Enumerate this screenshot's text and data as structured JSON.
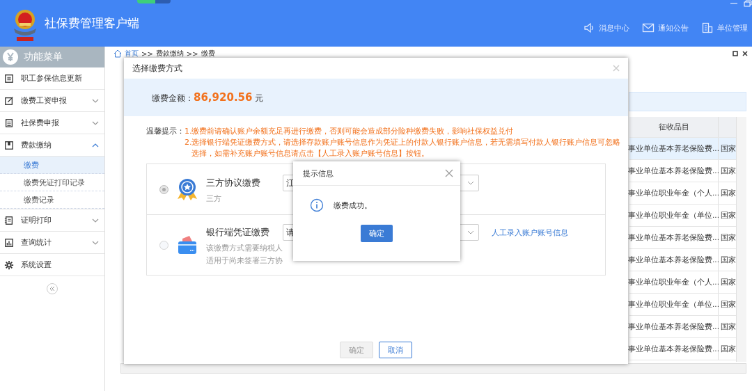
{
  "app": {
    "title": "社保费管理客户端"
  },
  "header_links": [
    {
      "label": "消息中心"
    },
    {
      "label": "通知公告"
    },
    {
      "label": "单位管理"
    }
  ],
  "sidebar": {
    "title": "功能菜单",
    "items": [
      {
        "label": "职工参保信息更新"
      },
      {
        "label": "缴费工资申报",
        "expanded": false
      },
      {
        "label": "社保费申报",
        "expanded": false
      },
      {
        "label": "费款缴纳",
        "expanded": true,
        "children": [
          {
            "label": "缴费",
            "selected": true
          },
          {
            "label": "缴费凭证打印记录",
            "selected": false
          },
          {
            "label": "缴费记录",
            "selected": false
          }
        ]
      },
      {
        "label": "证明打印",
        "expanded": false
      },
      {
        "label": "查询统计",
        "expanded": false
      },
      {
        "label": "系统设置"
      }
    ]
  },
  "breadcrumb": {
    "separator": ">>",
    "items": [
      "首页",
      "费款缴纳",
      "缴费"
    ]
  },
  "table": {
    "columns": [
      "征收品目"
    ],
    "rows": [
      {
        "cells": [
          "事业单位基本养老保险费...",
          "国家"
        ],
        "selected": true
      },
      {
        "cells": [
          "事业单位基本养老保险费...",
          "国家"
        ],
        "selected": false
      },
      {
        "cells": [
          "事业单位职业年金（个人...",
          "国家"
        ],
        "selected": false
      },
      {
        "cells": [
          "事业单位职业年金（单位...",
          "国家"
        ],
        "selected": false
      },
      {
        "cells": [
          "事业单位基本养老保险费...",
          "国家"
        ],
        "selected": false
      },
      {
        "cells": [
          "事业单位基本养老保险费...",
          "国家"
        ],
        "selected": false
      },
      {
        "cells": [
          "事业单位职业年金（个人...",
          "国家"
        ],
        "selected": false
      },
      {
        "cells": [
          "事业单位职业年金（单位...",
          "国家"
        ],
        "selected": false
      },
      {
        "cells": [
          "事业单位基本养老保险费...",
          "国家"
        ],
        "selected": false
      },
      {
        "cells": [
          "事业单位基本养老保险费...",
          "国家"
        ],
        "selected": false
      }
    ]
  },
  "payment_dialog": {
    "title": "选择缴费方式",
    "amount_label": "缴费金额：",
    "amount": "86,920.56",
    "currency": "元",
    "tip_label": "温馨提示：",
    "tips": [
      "1.缴费前请确认账户余额充足再进行缴费，否则可能会造成部分险种缴费失败，影响社保权益兑付",
      "2.选择银行端凭证缴费方式，请选择存款账户账号信息作为凭证上的付款人银行账户信息，若无需填写付款人银行账户信息可忽略选择，如需补充账户账号信息请点击【人工录入账户账号信息】按钮。"
    ],
    "options": [
      {
        "name": "三方协议缴费",
        "selected": true,
        "disabled": true,
        "select_value": "江",
        "description": [
          "三方"
        ]
      },
      {
        "name": "银行端凭证缴费",
        "selected": false,
        "disabled": false,
        "select_value": "请",
        "link": "人工录入账户账号信息",
        "description": [
          "该缴费方式需要纳税人",
          "适用于尚未签署三方协"
        ]
      }
    ],
    "buttons": [
      {
        "label": "确定",
        "disabled": true
      },
      {
        "label": "取消",
        "disabled": false
      }
    ]
  },
  "alert": {
    "title": "提示信息",
    "message": "缴费成功。",
    "button": "确定"
  }
}
